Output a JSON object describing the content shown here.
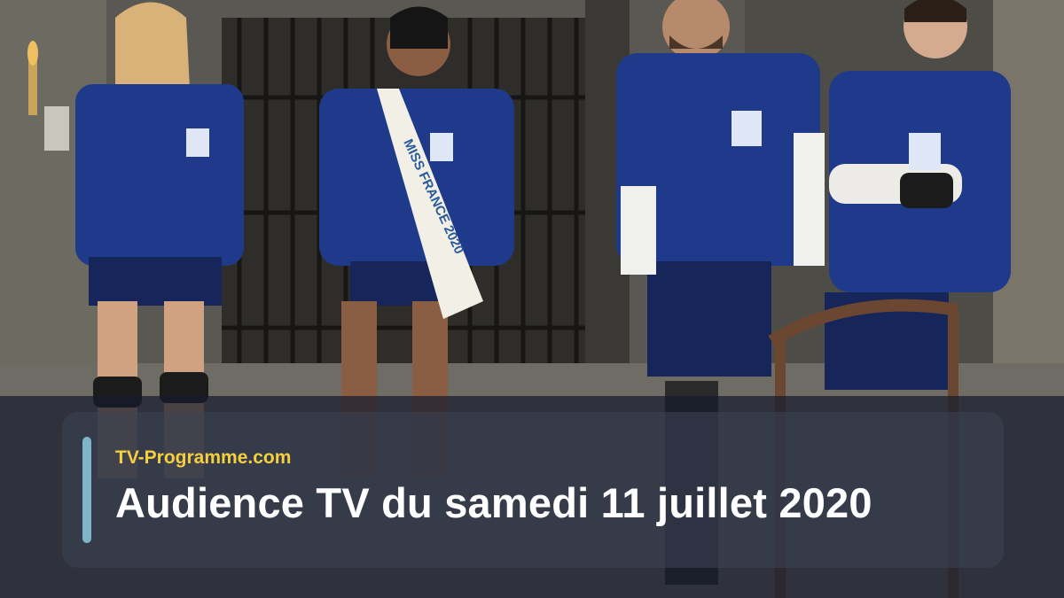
{
  "photo": {
    "description_icon": "photo-icon",
    "sash_text": "MISS FRANCE 2020"
  },
  "caption": {
    "site": "TV-Programme.com",
    "title": "Audience TV du samedi 11 juillet 2020"
  },
  "colors": {
    "site": "#f4d03f",
    "title": "#ffffff",
    "accent_bar": "#7fb4c9",
    "overlay": "#161c2c",
    "jersey": "#1f3a8a"
  }
}
